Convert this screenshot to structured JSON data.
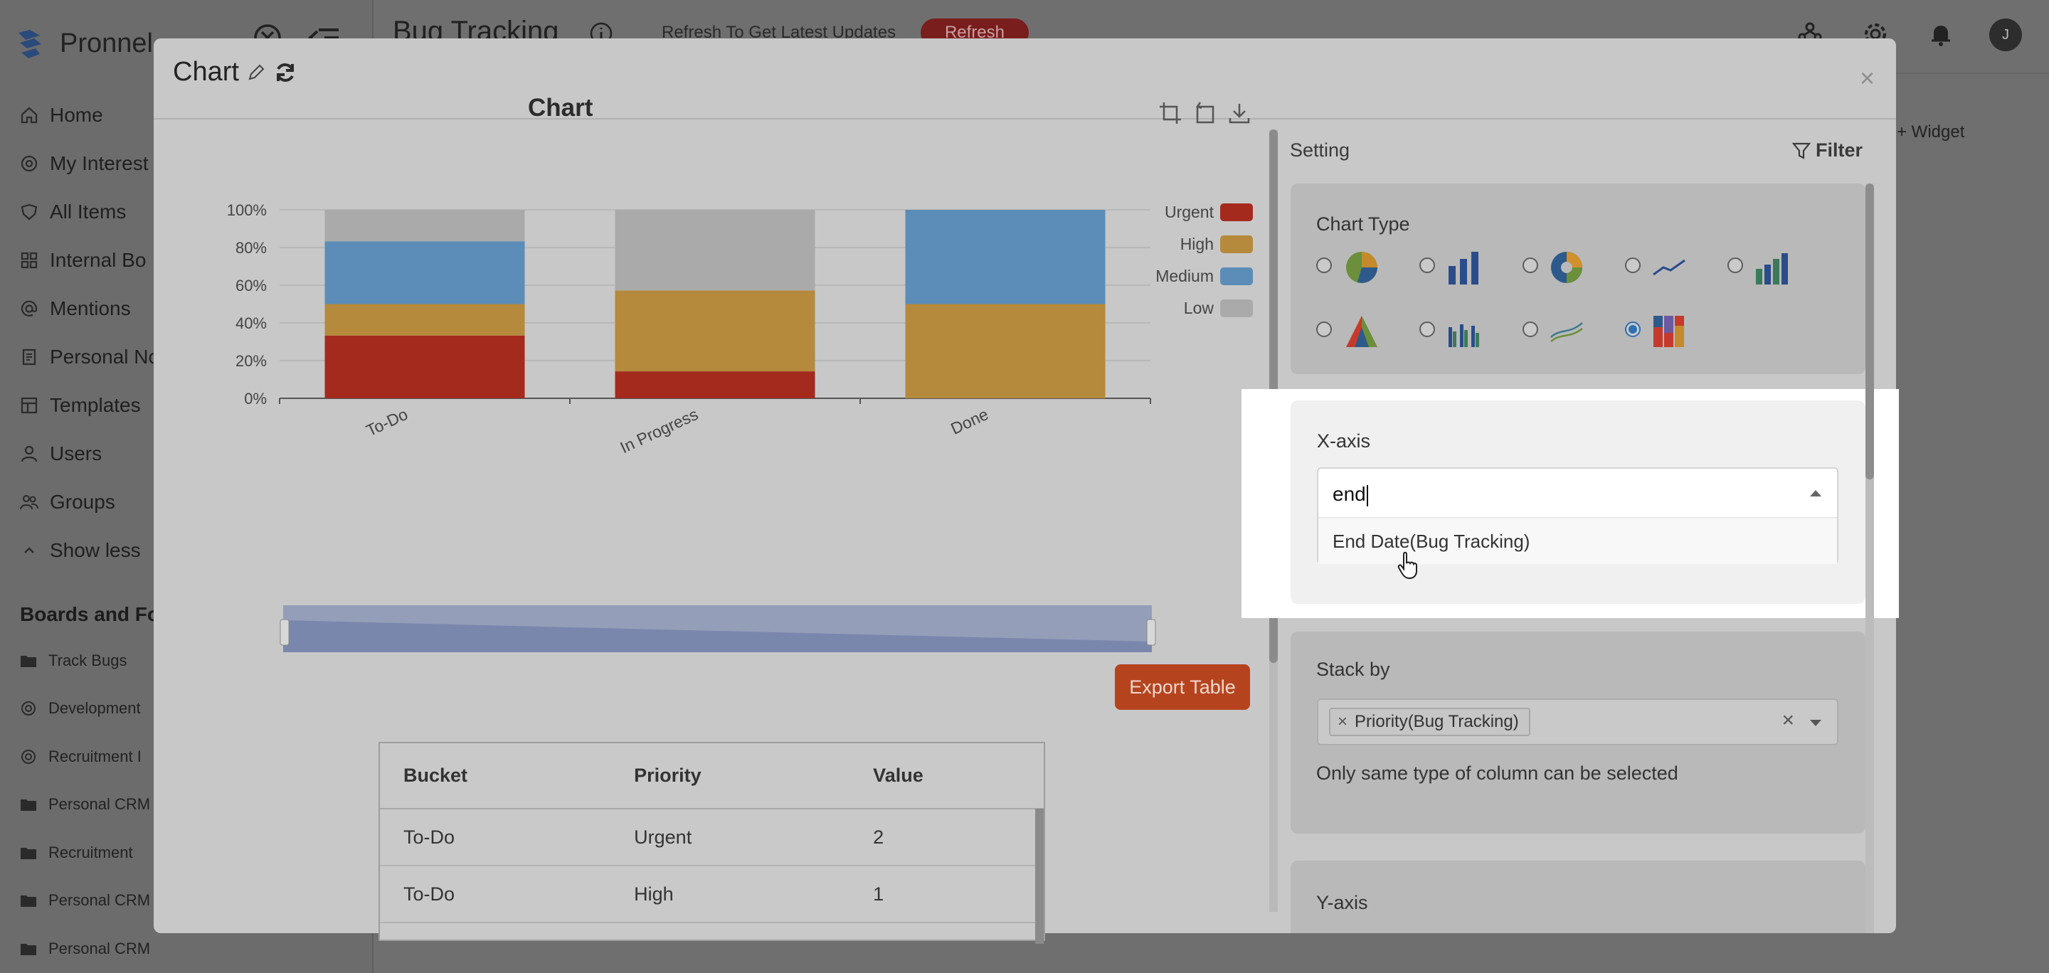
{
  "app": {
    "brand": "Pronnel",
    "title": "Bug Tracking",
    "refresh_text": "Refresh To Get Latest Updates",
    "refresh_button": "Refresh",
    "avatar_initial": "J",
    "add_widget": "+ Widget"
  },
  "sidebar": {
    "items": [
      {
        "label": "Home",
        "icon": "home-icon"
      },
      {
        "label": "My Interest",
        "icon": "interest-icon"
      },
      {
        "label": "All Items",
        "icon": "shield-icon"
      },
      {
        "label": "Internal Bo",
        "icon": "grid-icon"
      },
      {
        "label": "Mentions",
        "icon": "at-icon"
      },
      {
        "label": "Personal No",
        "icon": "note-icon"
      },
      {
        "label": "Templates",
        "icon": "template-icon"
      },
      {
        "label": "Users",
        "icon": "user-icon"
      },
      {
        "label": "Groups",
        "icon": "group-icon"
      },
      {
        "label": "Show less",
        "icon": "chevron-up-icon"
      }
    ],
    "section_title": "Boards and Fo",
    "boards": [
      {
        "label": "Track Bugs",
        "icon": "folder-icon"
      },
      {
        "label": "Development",
        "icon": "target-icon"
      },
      {
        "label": "Recruitment I",
        "icon": "target-icon"
      },
      {
        "label": "Personal CRM",
        "icon": "folder-icon"
      },
      {
        "label": "Recruitment",
        "icon": "folder-icon"
      },
      {
        "label": "Personal CRM",
        "icon": "folder-icon"
      },
      {
        "label": "Personal CRM",
        "icon": "folder-icon"
      }
    ]
  },
  "modal": {
    "title": "Chart",
    "close": "×",
    "export_button": "Export Table",
    "table": {
      "headers": [
        "Bucket",
        "Priority",
        "Value"
      ],
      "rows": [
        [
          "To-Do",
          "Urgent",
          "2"
        ],
        [
          "To-Do",
          "High",
          "1"
        ]
      ]
    }
  },
  "chart_data": {
    "type": "bar",
    "stacked": true,
    "percent": true,
    "title": "Chart",
    "categories": [
      "To-Do",
      "In Progress",
      "Done"
    ],
    "series": [
      {
        "name": "Urgent",
        "color": "#a52a1e",
        "values": [
          33.3,
          14.3,
          0
        ]
      },
      {
        "name": "High",
        "color": "#b58a3c",
        "values": [
          16.7,
          42.9,
          50
        ]
      },
      {
        "name": "Medium",
        "color": "#5b8db8",
        "values": [
          33.3,
          0,
          50
        ]
      },
      {
        "name": "Low",
        "color": "#aaaaaa",
        "values": [
          16.7,
          42.8,
          0
        ]
      }
    ],
    "y_ticks": [
      "0%",
      "20%",
      "40%",
      "60%",
      "80%",
      "100%"
    ],
    "ylim": [
      0,
      100
    ],
    "legend_position": "top-right",
    "grid": true
  },
  "settings": {
    "heading": "Setting",
    "filter_label": "Filter",
    "chart_type": {
      "label": "Chart Type",
      "options": [
        "pie-chart-icon",
        "bar-chart-icon",
        "donut-chart-icon",
        "line-chart-icon",
        "column-chart-icon",
        "funnel-chart-icon",
        "grouped-bar-icon",
        "area-line-icon",
        "stacked-bar-icon"
      ],
      "selected": "stacked-bar-icon"
    },
    "x_axis": {
      "label": "X-axis",
      "input_value": "end",
      "option": "End Date(Bug Tracking)"
    },
    "stack_by": {
      "label": "Stack by",
      "chip": "Priority(Bug Tracking)",
      "chip_remove": "×",
      "clear": "×",
      "hint": "Only same type of column can be selected"
    },
    "y_axis": {
      "label": "Y-axis"
    }
  }
}
